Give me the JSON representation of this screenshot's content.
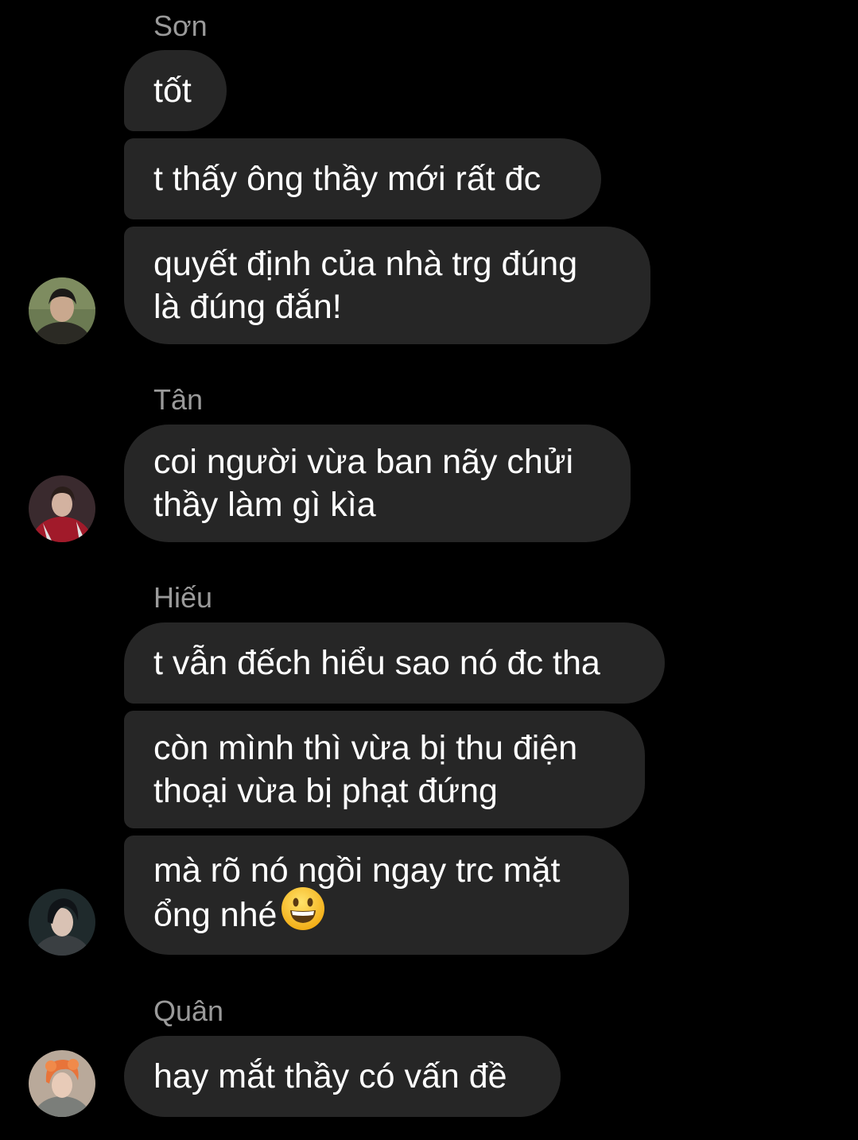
{
  "colors": {
    "background": "#000000",
    "bubble": "#262626",
    "name_text": "#9a9a9a",
    "message_text": "#ffffff"
  },
  "groups": [
    {
      "sender": "Sơn",
      "avatar_icon": "avatar-son-icon",
      "messages": [
        "tốt",
        "t thấy ông thầy mới rất đc",
        "quyết định của nhà trg đúng\nlà đúng đắn!"
      ]
    },
    {
      "sender": "Tân",
      "avatar_icon": "avatar-tan-icon",
      "messages": [
        "coi người vừa ban nãy chửi\nthầy làm gì kìa"
      ]
    },
    {
      "sender": "Hiếu",
      "avatar_icon": "avatar-hieu-icon",
      "messages": [
        "t vẫn đếch hiểu sao nó đc tha",
        "còn mình thì vừa bị thu điện\nthoại vừa bị phạt đứng",
        "mà rõ nó ngồi ngay trc mặt\nổng nhé"
      ],
      "emoji": "grinning-face-emoji"
    },
    {
      "sender": "Quân",
      "avatar_icon": "avatar-quan-icon",
      "messages": [
        "hay mắt thầy có vấn đề"
      ]
    }
  ]
}
